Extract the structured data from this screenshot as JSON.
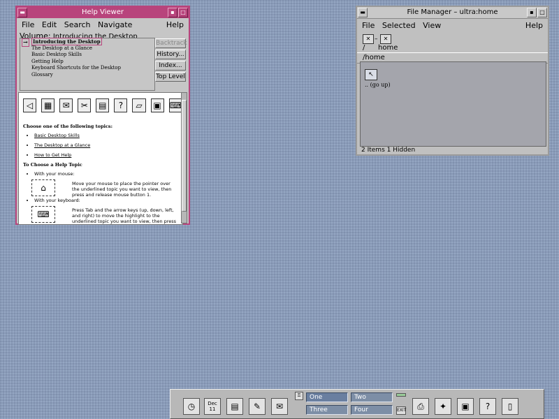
{
  "help_viewer": {
    "title": "Help Viewer",
    "menu": [
      "File",
      "Edit",
      "Search",
      "Navigate"
    ],
    "menu_help": "Help",
    "volume_label": "Volume:",
    "volume_value": "Introducing the Desktop",
    "topics": [
      "Introducing the Desktop",
      "The Desktop at a Glance",
      "Basic Desktop Skills",
      "Getting Help",
      "Keyboard Shortcuts for the Desktop",
      "Glossary"
    ],
    "buttons": {
      "backtrack": "Backtrack",
      "history": "History...",
      "index": "Index...",
      "top_level": "Top Level"
    },
    "body": {
      "choose_heading": "Choose one of the following topics:",
      "links": [
        "Basic Desktop Skills",
        "The Desktop at a Glance",
        "How to Get Help"
      ],
      "choose_topic_heading": "To Choose a Help Topic",
      "with_mouse": "With your mouse:",
      "mouse_text": "Move your mouse to place the pointer over the underlined topic you want to view, then press and release mouse button 1.",
      "with_keyboard": "With your keyboard:",
      "keyboard_text": "Press Tab and the arrow keys (up, down, left, and right) to move the highlight to the underlined topic you want to view, then press Return."
    }
  },
  "file_manager": {
    "title": "File Manager – ultra:home",
    "menu": [
      "File",
      "Selected",
      "View"
    ],
    "menu_help": "Help",
    "path_root": "/",
    "path_home": "home",
    "current_path": "/home",
    "go_up_label": ".. (go up)",
    "status": "2 Items 1 Hidden"
  },
  "front_panel": {
    "date_month": "Dec",
    "date_day": "11",
    "workspaces": [
      "One",
      "Two",
      "Three",
      "Four"
    ],
    "exit_label": "EXIT"
  }
}
